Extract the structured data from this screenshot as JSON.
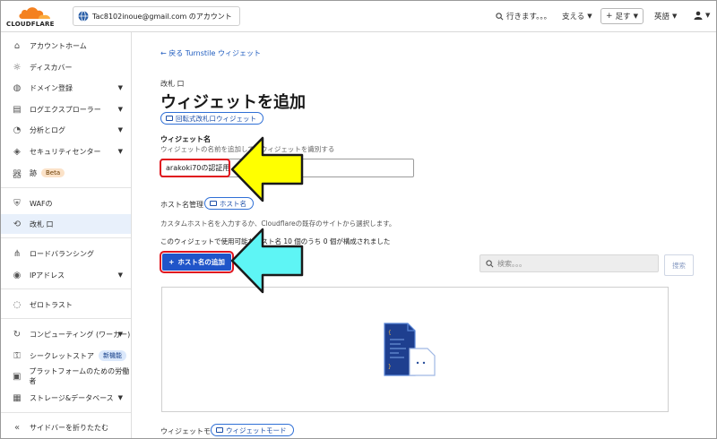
{
  "topbar": {
    "brand": "CLOUDFLARE",
    "account": "Tac8102inoue@gmail.com のアカウント",
    "search_placeholder": "行きます。。。",
    "support": "支える",
    "add": "足す",
    "language": "英語"
  },
  "sidebar": {
    "items": [
      {
        "label": "アカウントホーム",
        "icon": "home-icon"
      },
      {
        "label": "ディスカバー",
        "icon": "lightbulb-icon"
      },
      {
        "label": "ドメイン登録",
        "icon": "globe-icon",
        "chevron": true
      },
      {
        "label": "ログエクスプローラー",
        "icon": "log-icon",
        "chevron": true
      },
      {
        "label": "分析とログ",
        "icon": "clock-icon",
        "chevron": true
      },
      {
        "label": "セキュリティセンター",
        "icon": "security-center-icon",
        "chevron": true
      },
      {
        "label": "跡",
        "icon": "tree-icon",
        "badge": "Beta"
      },
      {
        "label": "WAFの",
        "icon": "shield-icon"
      },
      {
        "label": "改札 口",
        "icon": "turnstile-icon",
        "active": true
      },
      {
        "label": "ロードバランシング",
        "icon": "network-icon"
      },
      {
        "label": "IPアドレス",
        "icon": "pin-icon",
        "chevron": true
      },
      {
        "label": "ゼロトラスト",
        "icon": "zero-trust-icon"
      },
      {
        "label": "コンピューティング (ワーカー)",
        "icon": "compute-icon",
        "chevron": true
      },
      {
        "label": "シークレットストア",
        "icon": "key-icon",
        "badge": "新機能"
      },
      {
        "label": "プラットフォームのための労働者",
        "icon": "platform-icon"
      },
      {
        "label": "ストレージ&データベース",
        "icon": "database-icon",
        "chevron": true
      }
    ],
    "collapse": "サイドバーを折りたたむ"
  },
  "main": {
    "back_link": "← 戻る Turnstile ウィジェット",
    "eyebrow": "改札 口",
    "title": "ウィジェットを追加",
    "doc_button": "回転式改札口ウィジェット",
    "widget_name_label": "ウィジェット名",
    "widget_name_hint": "ウィジェットの名前を追加して、ウィジェットを識別する",
    "widget_name_value": "arakoki70の認証用",
    "hostname_label": "ホスト名管理",
    "hostname_button": "ホスト名",
    "hostname_desc": "カスタムホスト名を入力するか、Cloudflareの既存のサイトから選択します。",
    "hostname_count": "このウィジェットで使用可能なホスト名 10 個のうち 0 個が構成されました",
    "add_hostname_button": "ホスト名の追加",
    "search_placeholder": "検索。。。",
    "search_button": "捜索",
    "widget_mode_label": "ウィジェットモード",
    "widget_mode_button": "ウィジェットモード"
  },
  "colors": {
    "accent": "#2055c9",
    "highlight_red": "#e0141e",
    "arrow_yellow": "#ffff00",
    "arrow_cyan": "#5ef5f5",
    "brand_orange": "#f48120"
  }
}
